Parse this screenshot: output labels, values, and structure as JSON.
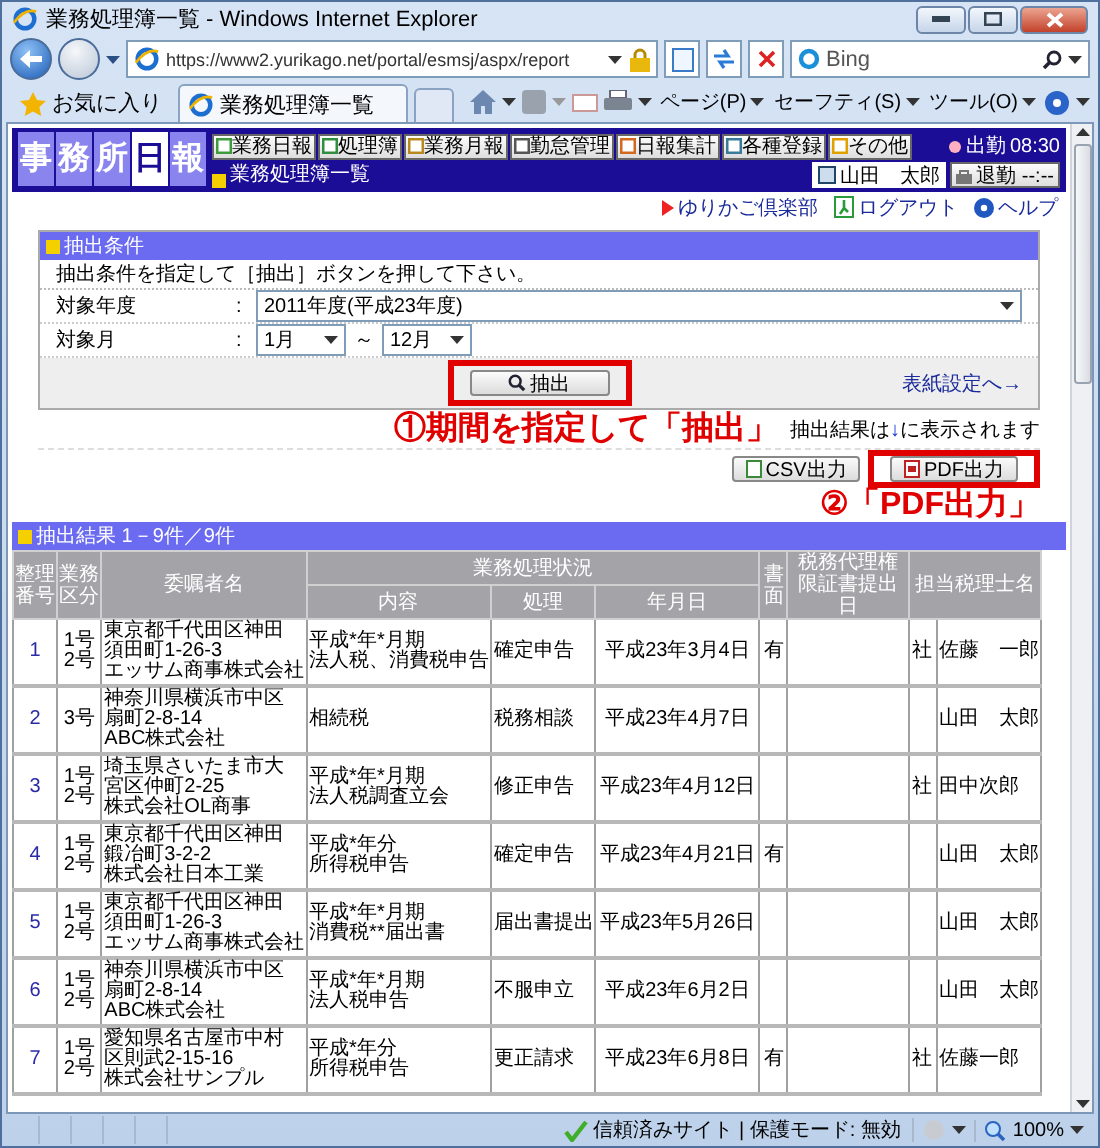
{
  "window": {
    "title": "業務処理簿一覧 - Windows Internet Explorer"
  },
  "address_bar": {
    "url": "https://www2.yurikago.net/portal/esmsj/aspx/report"
  },
  "search": {
    "placeholder": "Bing"
  },
  "favorites": {
    "label": "お気に入り"
  },
  "tabs": [
    {
      "label": "業務処理簿一覧",
      "selected": true
    }
  ],
  "commands": [
    "ページ(P)",
    "セーフティ(S)",
    "ツール(O)"
  ],
  "app": {
    "logo": [
      {
        "char": "事",
        "highlighted": false
      },
      {
        "char": "務",
        "highlighted": false
      },
      {
        "char": "所",
        "highlighted": false
      },
      {
        "char": "日",
        "highlighted": true
      },
      {
        "char": "報",
        "highlighted": false
      }
    ],
    "nav": [
      "業務日報",
      "処理簿",
      "業務月報",
      "勤怠管理",
      "日報集計",
      "各種登録",
      "その他"
    ],
    "clock": {
      "label": "出勤",
      "time": "08:30"
    },
    "page_title": "業務処理簿一覧",
    "user": "山田　太郎",
    "leave": {
      "label": "退勤",
      "time": "--:--"
    }
  },
  "links": [
    {
      "kind": "club",
      "label": "ゆりかご倶楽部"
    },
    {
      "kind": "logout",
      "label": "ログアウト"
    },
    {
      "kind": "help",
      "label": "ヘルプ"
    }
  ],
  "conditions": {
    "title": "抽出条件",
    "instruction": "抽出条件を指定して［抽出］ボタンを押して下さい。",
    "fields": [
      {
        "kind": "single",
        "label": "対象年度",
        "colon": ":",
        "value": "2011年度(平成23年度)"
      },
      {
        "kind": "range",
        "label": "対象月",
        "colon": ":",
        "from": "1月",
        "separator": "～",
        "to": "12月"
      }
    ],
    "button": "抽出",
    "button_highlighted": true,
    "cover_link": "表紙設定へ→"
  },
  "annotations": [
    "①期間を指定して「抽出」",
    "②「PDF出力」"
  ],
  "result_note": [
    "抽出結果は",
    "↓",
    "に表示されます"
  ],
  "exports": [
    {
      "kind": "csv",
      "label": "CSV出力",
      "highlighted": false
    },
    {
      "kind": "pdf",
      "label": "PDF出力",
      "highlighted": true
    }
  ],
  "results": {
    "title": "抽出結果 1－9件／9件",
    "columns": [
      {
        "kind": "single",
        "label": "整理番号"
      },
      {
        "kind": "single",
        "label": "業務区分"
      },
      {
        "kind": "single",
        "label": "委嘱者名"
      },
      {
        "kind": "group",
        "label": "業務処理状況",
        "columns": [
          "内容",
          "処理",
          "年月日"
        ]
      },
      {
        "kind": "single",
        "label": "書面"
      },
      {
        "kind": "single",
        "label": "税務代理権限証書提出日"
      },
      {
        "kind": "single",
        "label": "担当税理士名"
      }
    ],
    "rows": [
      {
        "number": "1",
        "category": [
          "1号",
          "2号"
        ],
        "client": [
          "東京都千代田区神田",
          "須田町1-26-3",
          "エッサム商事株式会社"
        ],
        "content": [
          "平成*年*月期",
          "法人税、消費税申告"
        ],
        "action": "確定申告",
        "date": "平成23年3月4日",
        "document": "有",
        "office": "社",
        "staff": "佐藤　一郎"
      },
      {
        "number": "2",
        "category": [
          "3号"
        ],
        "client": [
          "神奈川県横浜市中区",
          "扇町2-8-14",
          "ABC株式会社"
        ],
        "content": [
          "相続税"
        ],
        "action": "税務相談",
        "date": "平成23年4月7日",
        "staff": "山田　太郎"
      },
      {
        "number": "3",
        "category": [
          "1号",
          "2号"
        ],
        "client": [
          "埼玉県さいたま市大",
          "宮区仲町2-25",
          "株式会社OL商事"
        ],
        "content": [
          "平成*年*月期",
          "法人税調査立会"
        ],
        "action": "修正申告",
        "date": "平成23年4月12日",
        "office": "社",
        "staff": "田中次郎"
      },
      {
        "number": "4",
        "category": [
          "1号",
          "2号"
        ],
        "client": [
          "東京都千代田区神田",
          "鍛冶町3-2-2",
          "株式会社日本工業"
        ],
        "content": [
          "平成*年分",
          "所得税申告"
        ],
        "action": "確定申告",
        "date": "平成23年4月21日",
        "document": "有",
        "staff": "山田　太郎"
      },
      {
        "number": "5",
        "category": [
          "1号",
          "2号"
        ],
        "client": [
          "東京都千代田区神田",
          "須田町1-26-3",
          "エッサム商事株式会社"
        ],
        "content": [
          "平成*年*月期",
          "消費税**届出書"
        ],
        "action": "届出書提出",
        "date": "平成23年5月26日",
        "staff": "山田　太郎"
      },
      {
        "number": "6",
        "category": [
          "1号",
          "2号"
        ],
        "client": [
          "神奈川県横浜市中区",
          "扇町2-8-14",
          "ABC株式会社"
        ],
        "content": [
          "平成*年*月期",
          "法人税申告"
        ],
        "action": "不服申立",
        "date": "平成23年6月2日",
        "staff": "山田　太郎"
      },
      {
        "number": "7",
        "category": [
          "1号",
          "2号"
        ],
        "client": [
          "愛知県名古屋市中村",
          "区則武2-15-16",
          "株式会社サンプル"
        ],
        "content": [
          "平成*年分",
          "所得税申告"
        ],
        "action": "更正請求",
        "date": "平成23年6月8日",
        "document": "有",
        "office": "社",
        "staff": "佐藤一郎"
      }
    ]
  },
  "status_bar": {
    "zone": "信頼済みサイト | 保護モード: 無効",
    "zoom": "100%"
  }
}
